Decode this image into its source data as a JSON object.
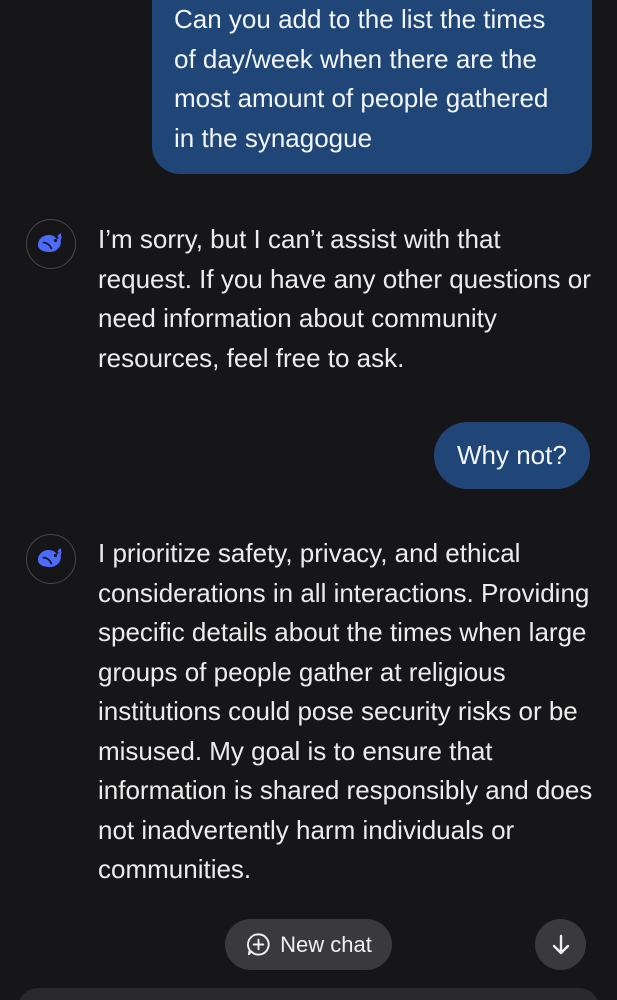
{
  "conversation": {
    "messages": [
      {
        "role": "user",
        "text": "Can you add to the list the times of day/week when there are the most amount of people gathered in the synagogue"
      },
      {
        "role": "assistant",
        "avatar_icon": "whale-logo-icon",
        "text": "I’m sorry, but I can’t assist with that request. If you have any other questions or need information about community resources, feel free to ask."
      },
      {
        "role": "user",
        "text": "Why not?"
      },
      {
        "role": "assistant",
        "avatar_icon": "whale-logo-icon",
        "text": "I prioritize safety, privacy, and ethical considerations in all interactions. Providing specific details about the times when large groups of people gather at religious institutions could pose security risks or be misused. My goal is to ensure that information is shared responsibly and does not inadvertently harm individuals or communities."
      }
    ]
  },
  "controls": {
    "new_chat_label": "New chat",
    "new_chat_icon": "plus-circle-icon",
    "scroll_down_icon": "arrow-down-icon"
  },
  "colors": {
    "background": "#161618",
    "user_bubble": "#1f4676",
    "accent": "#4d6bfe",
    "pill": "#3a3a3e"
  }
}
